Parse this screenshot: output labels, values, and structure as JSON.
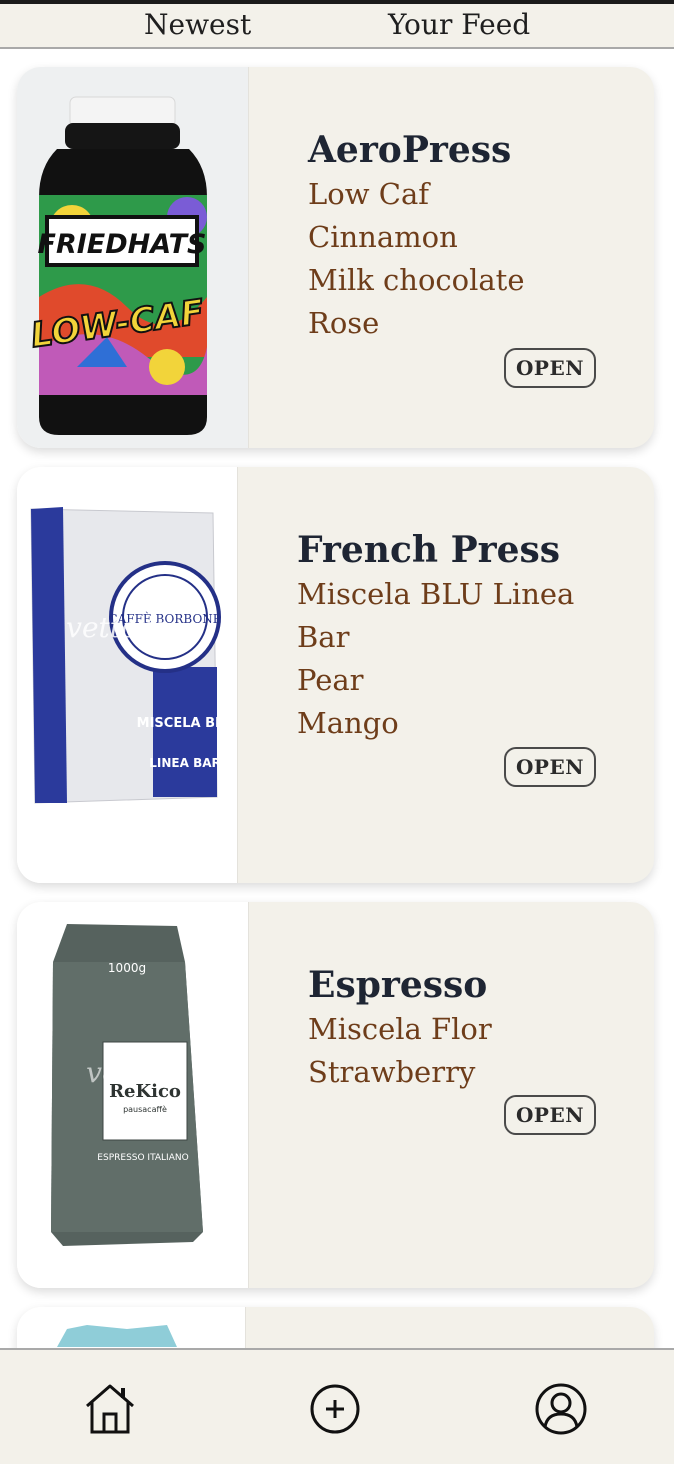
{
  "tabs": {
    "newest": "Newest",
    "your_feed": "Your Feed"
  },
  "cards": [
    {
      "method": "AeroPress",
      "lines": [
        "Low Caf",
        "Cinnamon",
        "Milk chocolate",
        "Rose"
      ],
      "open_label": "OPEN",
      "image": {
        "brand": "FRIEDHATS",
        "label": "LOW-CAF"
      }
    },
    {
      "method": "French Press",
      "lines": [
        "Miscela BLU Linea",
        "Bar",
        "Pear",
        "Mango"
      ],
      "open_label": "OPEN",
      "image": {
        "brand": "CAFFÈ BORBONE",
        "label": "MISCELA BLU",
        "sub": "LINEA BAR",
        "watermark": "vettore"
      }
    },
    {
      "method": "Espresso",
      "lines": [
        "Miscela Flor",
        "Strawberry"
      ],
      "open_label": "OPEN",
      "image": {
        "brand": "ReKico",
        "weight": "1000g",
        "sub": "pausacaffè",
        "label": "ESPRESSO ITALIANO",
        "watermark": "vettore"
      }
    }
  ],
  "nav": {
    "icons": [
      "home-icon",
      "plus-circle-icon",
      "user-icon"
    ]
  },
  "colors": {
    "card_bg": "#f3f1ea",
    "title": "#1e2533",
    "note": "#6e3d1a",
    "border": "#a9a9a9"
  }
}
